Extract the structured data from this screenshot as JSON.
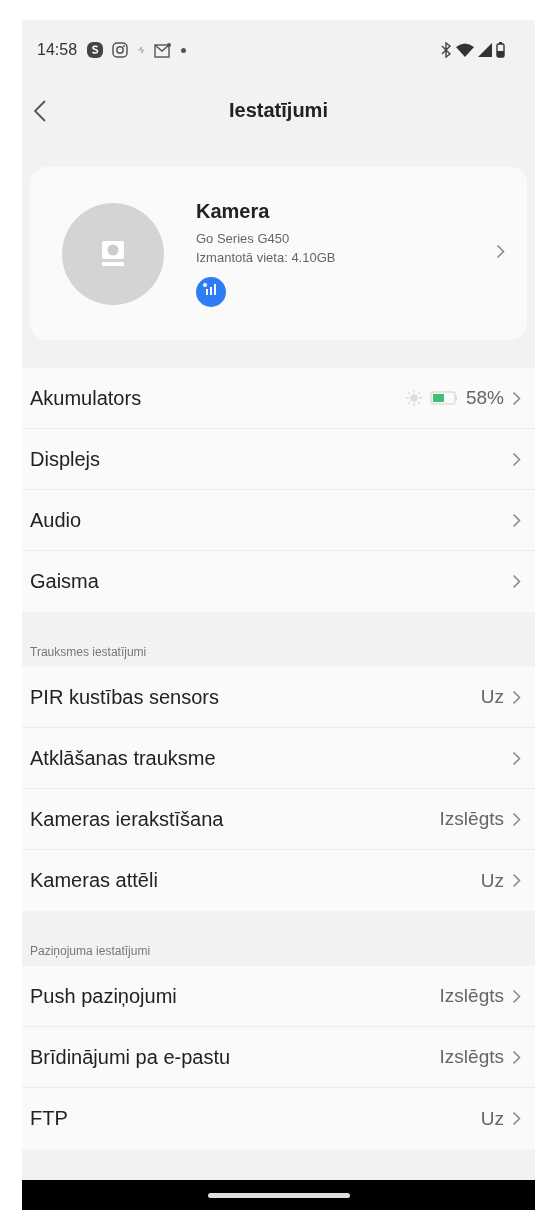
{
  "status_bar": {
    "time": "14:58"
  },
  "header": {
    "title": "Iestatījumi"
  },
  "device": {
    "name": "Kamera",
    "model": "Go Series G450",
    "storage": "Izmantotā vieta: 4.10GB"
  },
  "sections": [
    {
      "rows": [
        {
          "kind": "battery",
          "label": "Akumulators",
          "value": "58%"
        },
        {
          "kind": "plain",
          "label": "Displejs"
        },
        {
          "kind": "plain",
          "label": "Audio"
        },
        {
          "kind": "plain",
          "label": "Gaisma"
        }
      ]
    },
    {
      "title": "Trauksmes iestatījumi",
      "rows": [
        {
          "kind": "plain",
          "label": "PIR kustības sensors",
          "value": "Uz"
        },
        {
          "kind": "plain",
          "label": "Atklāšanas trauksme"
        },
        {
          "kind": "plain",
          "label": "Kameras ierakstīšana",
          "value": "Izslēgts"
        },
        {
          "kind": "plain",
          "label": "Kameras attēli",
          "value": "Uz"
        }
      ]
    },
    {
      "title": "Paziņojuma iestatījumi",
      "rows": [
        {
          "kind": "plain",
          "label": "Push paziņojumi",
          "value": "Izslēgts"
        },
        {
          "kind": "plain",
          "label": "Brīdinājumi pa e-pastu",
          "value": "Izslēgts"
        },
        {
          "kind": "plain",
          "label": "FTP",
          "value": "Uz"
        }
      ]
    }
  ]
}
